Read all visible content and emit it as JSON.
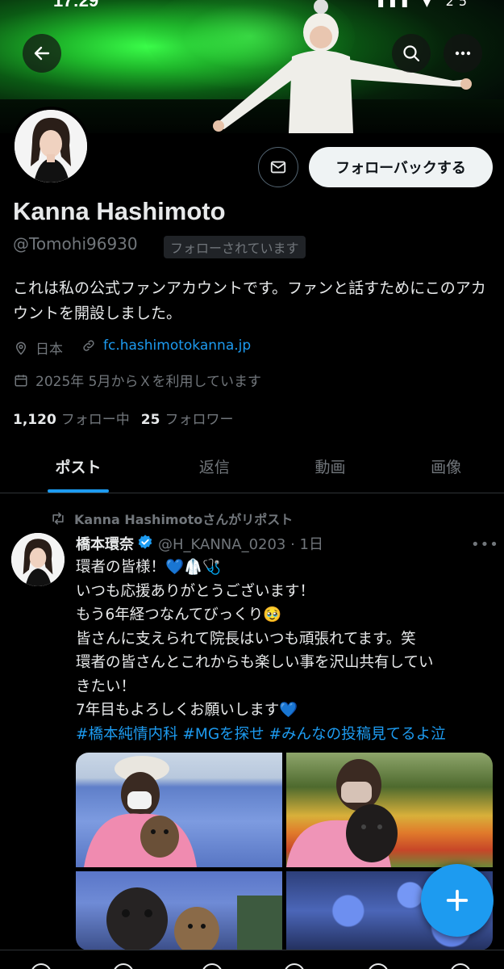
{
  "status_bar": {
    "time": "17:29",
    "icons": "▮▮▮ ▼ 25"
  },
  "header": {
    "back_icon": "arrow-left-icon",
    "search_icon": "search-icon",
    "more_icon": "more-horizontal-icon"
  },
  "profile": {
    "display_name": "Kanna Hashimoto",
    "handle": "@Tomohi96930",
    "follows_you_badge": "フォローされています",
    "bio": "これは私の公式ファンアカウントです。ファンと話すためにこのアカウントを開設しました。",
    "location": "日本",
    "website": "fc.hashimotokanna.jp",
    "joined": "2025年 5月からＸを利用しています",
    "following_count": "1,120",
    "following_label": "フォロー中",
    "followers_count": "25",
    "followers_label": "フォロワー",
    "message_button_icon": "mail-icon",
    "follow_back_button": "フォローバックする"
  },
  "tabs": [
    {
      "label": "ポスト",
      "active": true
    },
    {
      "label": "返信",
      "active": false
    },
    {
      "label": "動画",
      "active": false
    },
    {
      "label": "画像",
      "active": false
    }
  ],
  "post": {
    "repost_label": "Kanna Hashimotoさんがリポスト",
    "author_name": "橋本環奈",
    "author_handle_time": "@H_KANNA_0203 · 1日",
    "lines": [
      "環者の皆様！💙🥼🩺",
      "いつも応援ありがとうございます！",
      "もう6年経つなんてびっくり🥹",
      "皆さんに支えられて院長はいつも頑張れてます。笑",
      "環者の皆さんとこれからも楽しい事を沢山共有してい",
      "きたい！",
      "7年目もよろしくお願いします💙"
    ],
    "hashtags": "#橋本純情内科 #MGを探せ #みんなの投稿見てるよ泣"
  },
  "colors": {
    "accent": "#1d9bf0",
    "background": "#000000",
    "text_primary": "#e7e9ea",
    "text_secondary": "#71767b",
    "follow_button_bg": "#eff3f4"
  },
  "fab": {
    "icon": "plus-icon"
  }
}
